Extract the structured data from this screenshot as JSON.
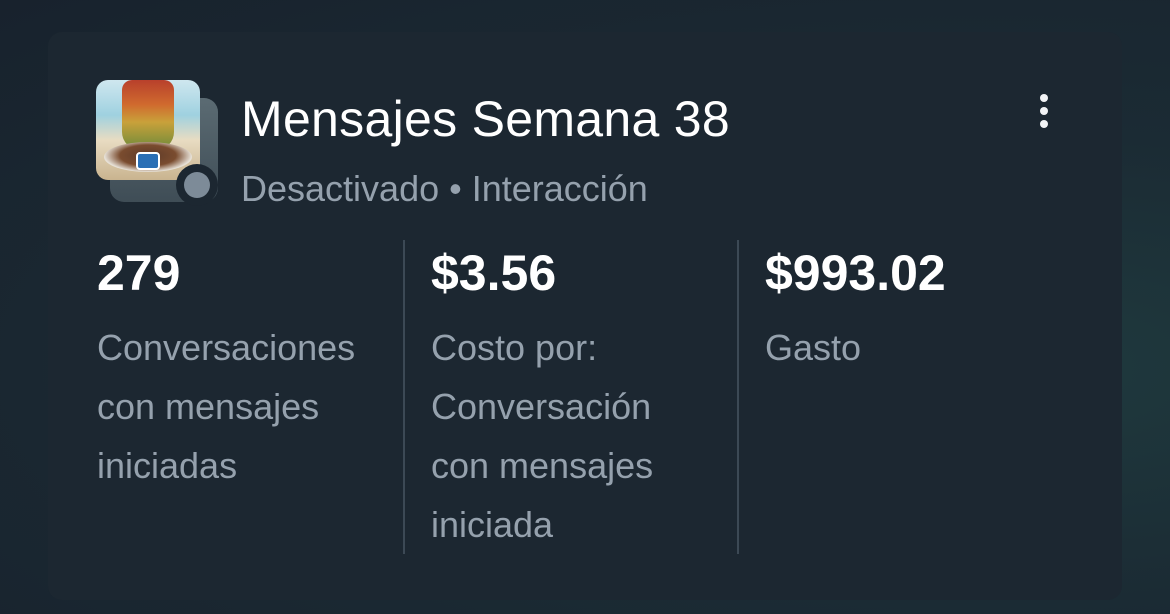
{
  "campaign": {
    "title": "Mensajes Semana 38",
    "status": "Desactivado",
    "separator": "•",
    "objective": "Interacción",
    "status_color": "#7d8b98",
    "more_icon": "more-vertical-icon"
  },
  "metrics": [
    {
      "value": "279",
      "label_lines": [
        "Conversaciones",
        "con mensajes",
        "iniciadas"
      ]
    },
    {
      "value": "$3.56",
      "label_lines": [
        "Costo por:",
        "Conversación",
        "con mensajes",
        "iniciada"
      ]
    },
    {
      "value": "$993.02",
      "label_lines": [
        "Gasto"
      ]
    }
  ]
}
